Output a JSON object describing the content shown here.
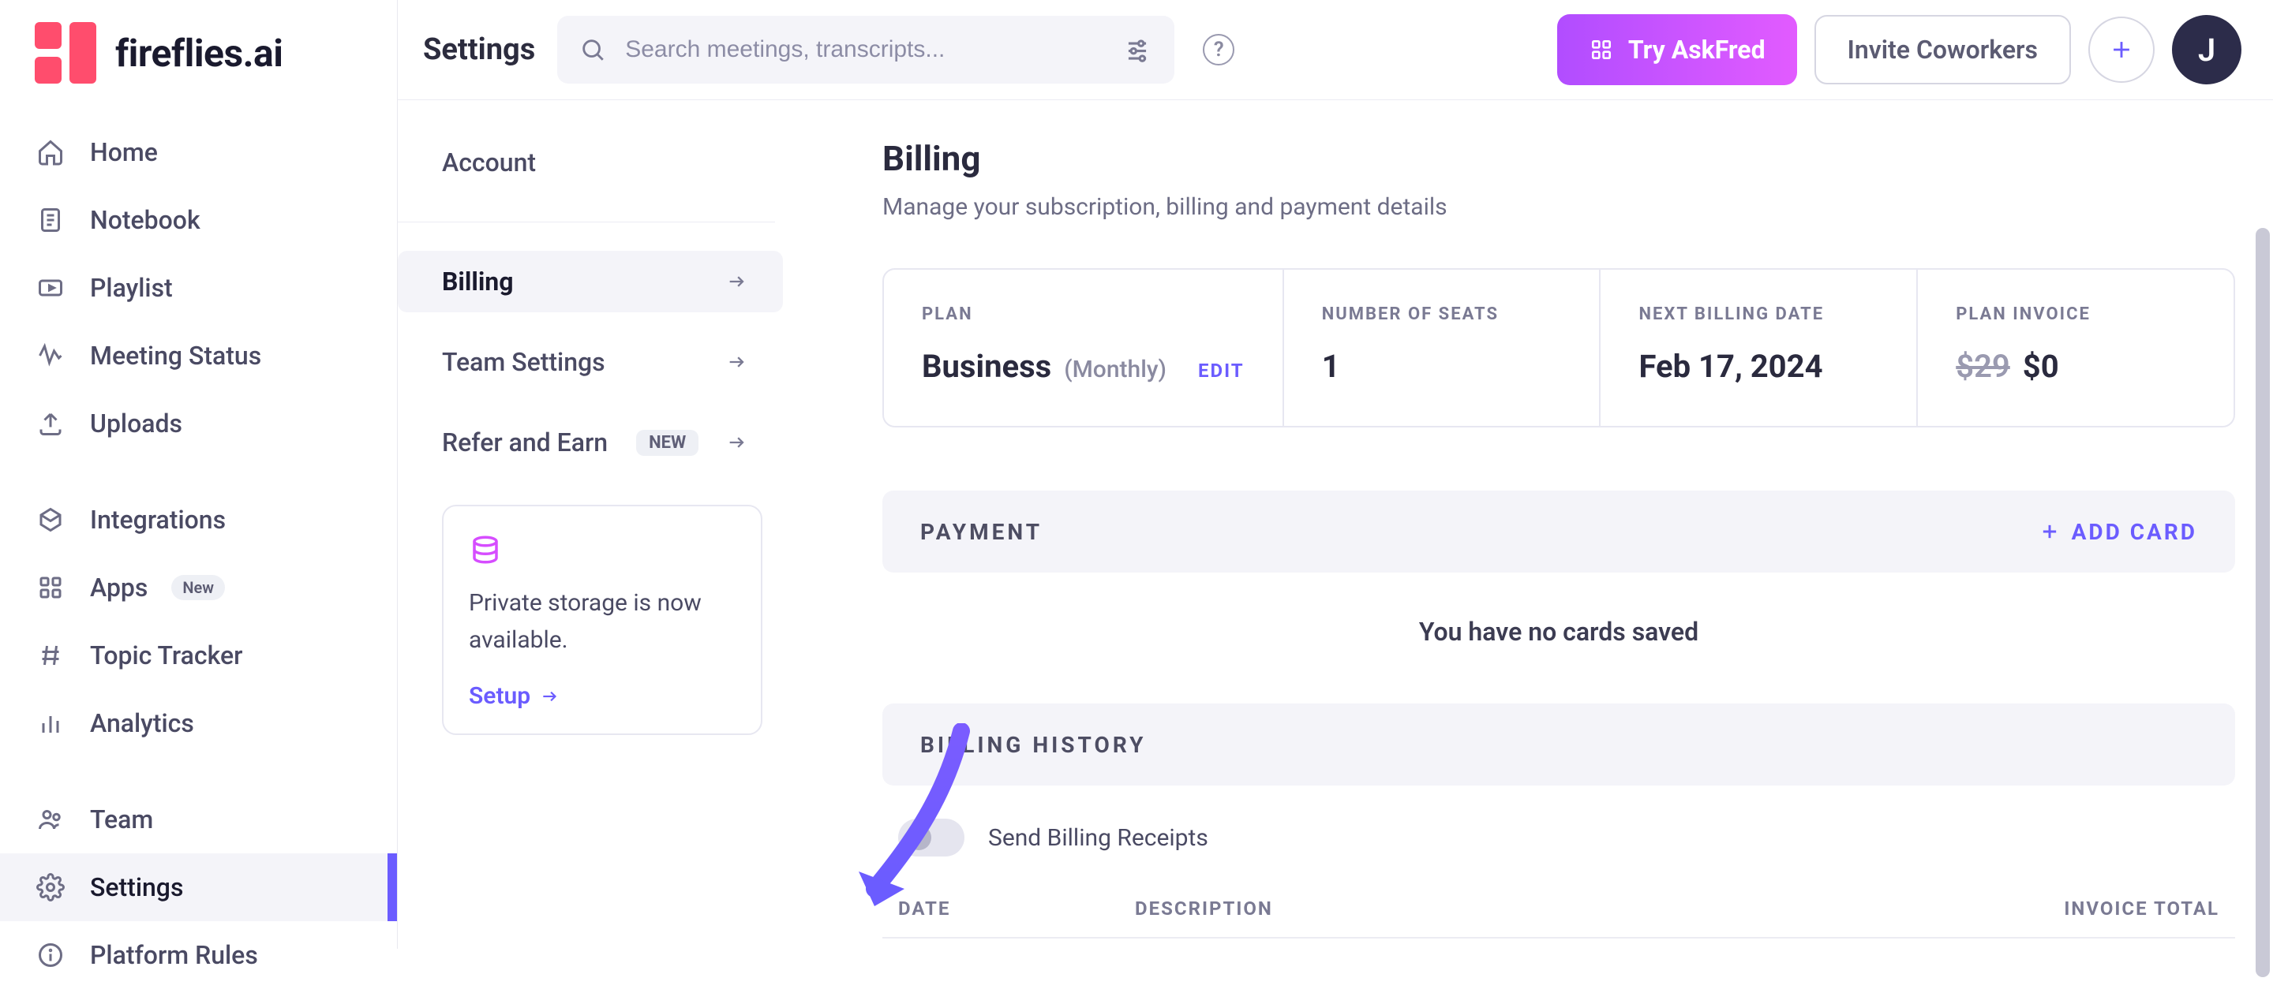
{
  "brand": "fireflies.ai",
  "sidebar": {
    "items": [
      {
        "label": "Home"
      },
      {
        "label": "Notebook"
      },
      {
        "label": "Playlist"
      },
      {
        "label": "Meeting Status"
      },
      {
        "label": "Uploads"
      },
      {
        "label": "Integrations"
      },
      {
        "label": "Apps",
        "pill": "New"
      },
      {
        "label": "Topic Tracker"
      },
      {
        "label": "Analytics"
      },
      {
        "label": "Team"
      },
      {
        "label": "Settings",
        "active": true
      },
      {
        "label": "Platform Rules"
      }
    ]
  },
  "topbar": {
    "title": "Settings",
    "search_placeholder": "Search meetings, transcripts...",
    "try_askfred": "Try AskFred",
    "invite": "Invite Coworkers",
    "avatar_initial": "J"
  },
  "settings_nav": {
    "account": "Account",
    "billing": "Billing",
    "team": "Team Settings",
    "refer": "Refer and Earn",
    "refer_badge": "NEW",
    "storage_text": "Private storage is now available.",
    "storage_link": "Setup"
  },
  "billing": {
    "title": "Billing",
    "subtitle": "Manage your subscription, billing and payment details",
    "plan": {
      "label": "PLAN",
      "name": "Business",
      "period": "(Monthly)",
      "edit": "EDIT"
    },
    "seats": {
      "label": "NUMBER OF SEATS",
      "value": "1"
    },
    "next_date": {
      "label": "NEXT BILLING DATE",
      "value": "Feb 17, 2024"
    },
    "invoice": {
      "label": "PLAN INVOICE",
      "strike": "$29",
      "value": "$0"
    },
    "payment_title": "PAYMENT",
    "add_card": "ADD CARD",
    "no_cards": "You have no cards saved",
    "history_title": "BILLING HISTORY",
    "send_receipts": "Send Billing Receipts",
    "hist_date": "DATE",
    "hist_desc": "DESCRIPTION",
    "hist_total": "INVOICE TOTAL"
  }
}
